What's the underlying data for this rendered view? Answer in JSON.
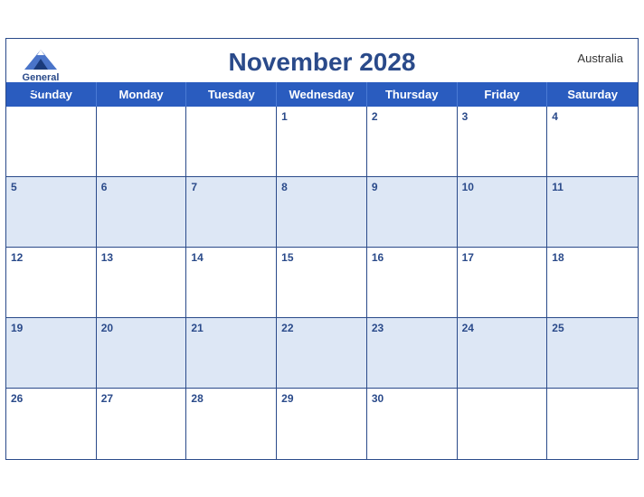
{
  "header": {
    "title": "November 2028",
    "country": "Australia",
    "logo": {
      "general": "General",
      "blue": "Blue"
    }
  },
  "dayHeaders": [
    "Sunday",
    "Monday",
    "Tuesday",
    "Wednesday",
    "Thursday",
    "Friday",
    "Saturday"
  ],
  "weeks": [
    [
      {
        "num": "",
        "empty": true
      },
      {
        "num": "",
        "empty": true
      },
      {
        "num": "",
        "empty": true
      },
      {
        "num": "1",
        "empty": false
      },
      {
        "num": "2",
        "empty": false
      },
      {
        "num": "3",
        "empty": false
      },
      {
        "num": "4",
        "empty": false
      }
    ],
    [
      {
        "num": "5",
        "empty": false
      },
      {
        "num": "6",
        "empty": false
      },
      {
        "num": "7",
        "empty": false
      },
      {
        "num": "8",
        "empty": false
      },
      {
        "num": "9",
        "empty": false
      },
      {
        "num": "10",
        "empty": false
      },
      {
        "num": "11",
        "empty": false
      }
    ],
    [
      {
        "num": "12",
        "empty": false
      },
      {
        "num": "13",
        "empty": false
      },
      {
        "num": "14",
        "empty": false
      },
      {
        "num": "15",
        "empty": false
      },
      {
        "num": "16",
        "empty": false
      },
      {
        "num": "17",
        "empty": false
      },
      {
        "num": "18",
        "empty": false
      }
    ],
    [
      {
        "num": "19",
        "empty": false
      },
      {
        "num": "20",
        "empty": false
      },
      {
        "num": "21",
        "empty": false
      },
      {
        "num": "22",
        "empty": false
      },
      {
        "num": "23",
        "empty": false
      },
      {
        "num": "24",
        "empty": false
      },
      {
        "num": "25",
        "empty": false
      }
    ],
    [
      {
        "num": "26",
        "empty": false
      },
      {
        "num": "27",
        "empty": false
      },
      {
        "num": "28",
        "empty": false
      },
      {
        "num": "29",
        "empty": false
      },
      {
        "num": "30",
        "empty": false
      },
      {
        "num": "",
        "empty": true
      },
      {
        "num": "",
        "empty": true
      }
    ]
  ],
  "colors": {
    "headerBg": "#2a5cbf",
    "darkBlue": "#2a4a8a",
    "altRowBg": "#dde7f5",
    "white": "#ffffff"
  }
}
